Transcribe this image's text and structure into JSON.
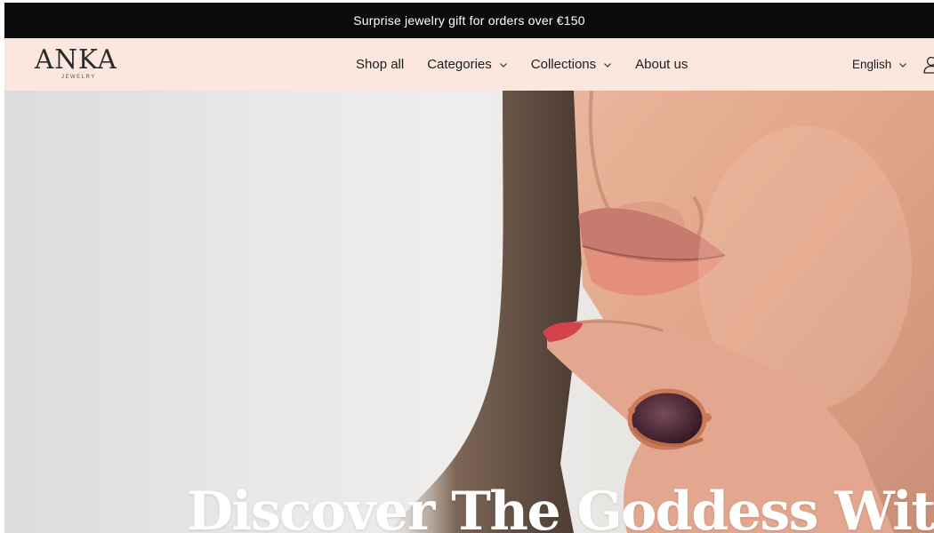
{
  "announcement": {
    "text": "Surprise jewelry gift for orders over €150"
  },
  "brand": {
    "name": "ANKA",
    "tagline": "JEWELRY"
  },
  "nav": {
    "items": [
      {
        "label": "Shop all",
        "has_dropdown": false
      },
      {
        "label": "Categories",
        "has_dropdown": true
      },
      {
        "label": "Collections",
        "has_dropdown": true
      },
      {
        "label": "About us",
        "has_dropdown": false
      }
    ]
  },
  "language": {
    "label": "English",
    "icon": "chevron-down-icon"
  },
  "account": {
    "icon": "user-icon"
  },
  "hero": {
    "title": "Discover The Goddess Within"
  },
  "colors": {
    "announcement_bg": "#0b0b0b",
    "header_bg": "#fbe7de",
    "hero_title": "#ffffff"
  }
}
